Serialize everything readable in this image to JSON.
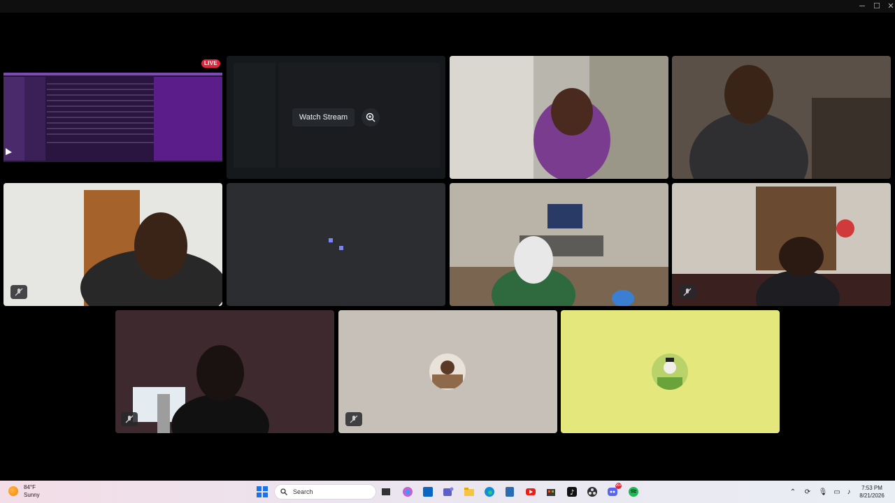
{
  "window": {
    "minimize_label": "─",
    "maximize_label": "☐",
    "close_label": "✕"
  },
  "call": {
    "live_badge": "LIVE",
    "watch_stream_label": "Watch Stream"
  },
  "taskbar": {
    "weather_temp": "84°F",
    "weather_desc": "Sunny",
    "search_placeholder": "Search",
    "time": "7:53 PM",
    "date": "8/21/2026",
    "discord_badge": "99+"
  },
  "colors": {
    "accent_live": "#e0263a",
    "tile_gray": "#c6c0b8",
    "tile_yellow": "#e4e77c",
    "tile_empty": "#2b2d31"
  },
  "icons": [
    "windows-start-icon",
    "search-icon",
    "task-view-icon",
    "copilot-icon",
    "store-icon",
    "teams-icon",
    "file-explorer-icon",
    "edge-icon",
    "calculator-icon",
    "youtube-icon",
    "microsoft-store-icon",
    "tiktok-icon",
    "obs-icon",
    "discord-icon",
    "spotify-icon"
  ]
}
